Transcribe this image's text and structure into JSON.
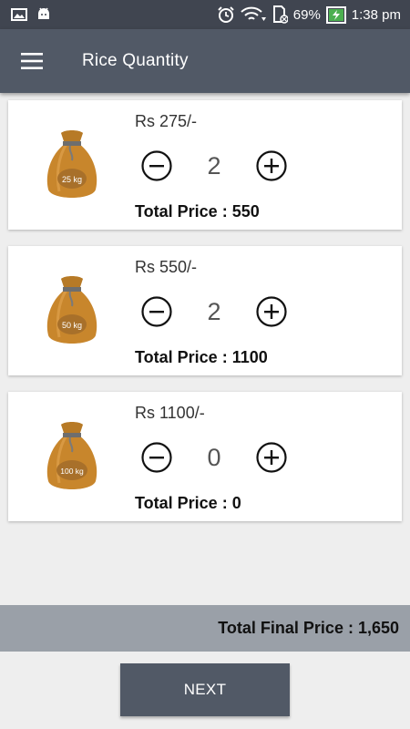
{
  "status_bar": {
    "battery": "69%",
    "time": "1:38 pm"
  },
  "toolbar": {
    "title": "Rice Quantity"
  },
  "items": [
    {
      "price": "Rs 275/-",
      "quantity": "2",
      "total": "Total Price : 550",
      "bag_label": "25 kg"
    },
    {
      "price": "Rs 550/-",
      "quantity": "2",
      "total": "Total Price : 1100",
      "bag_label": "50 kg"
    },
    {
      "price": "Rs 1100/-",
      "quantity": "0",
      "total": "Total Price : 0",
      "bag_label": "100 kg"
    }
  ],
  "footer": {
    "final_total": "Total Final Price : 1,650",
    "next_label": "NEXT"
  },
  "colors": {
    "toolbar": "#515966",
    "status_bar": "#404550",
    "background": "#eeeeee",
    "bag": "#c8862c",
    "footer_bar": "#9aa0a8"
  }
}
